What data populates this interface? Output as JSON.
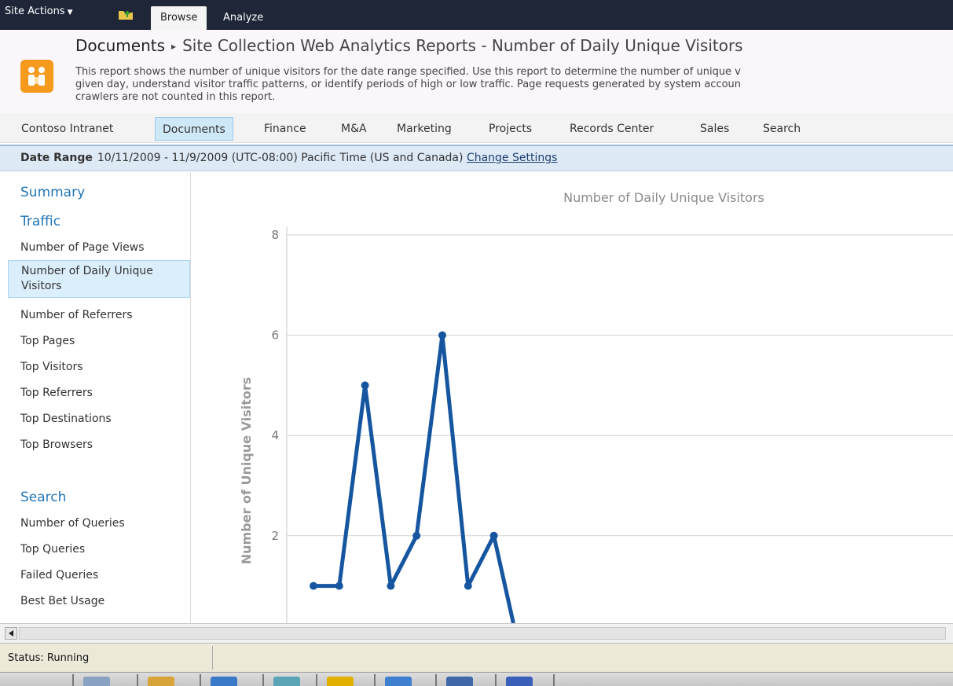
{
  "ribbon": {
    "site_actions_label": "Site Actions",
    "tabs": [
      {
        "label": "Browse",
        "active": true
      },
      {
        "label": "Analyze",
        "active": false
      }
    ]
  },
  "title": {
    "breadcrumb_root": "Documents",
    "breadcrumb_separator": "▸",
    "page_title": "Site Collection Web Analytics Reports - Number of Daily Unique Visitors",
    "description_lines": [
      "This report shows the number of unique visitors for the date range specified. Use this report to determine the number of unique v",
      "given day, understand visitor traffic patterns, or identify periods of high or low traffic. Page requests generated by system accoun",
      "crawlers are not counted in this report."
    ]
  },
  "topnav": {
    "items": [
      {
        "label": "Contoso Intranet"
      },
      {
        "label": "Documents",
        "selected": true
      },
      {
        "label": "Finance"
      },
      {
        "label": "M&A"
      },
      {
        "label": "Marketing"
      },
      {
        "label": "Projects"
      },
      {
        "label": "Records Center"
      },
      {
        "label": "Sales"
      },
      {
        "label": "Search"
      }
    ]
  },
  "date_range": {
    "label": "Date Range",
    "value": "10/11/2009 - 11/9/2009 (UTC-08:00) Pacific Time (US and Canada)",
    "change_link": "Change Settings"
  },
  "quick_launch": {
    "summary": "Summary",
    "traffic_heading": "Traffic",
    "traffic_items": [
      "Number of Page Views",
      "Number of Daily Unique Visitors",
      "Number of Referrers",
      "Top Pages",
      "Top Visitors",
      "Top Referrers",
      "Top Destinations",
      "Top Browsers"
    ],
    "selected_item": "Number of Daily Unique Visitors",
    "search_heading": "Search",
    "search_items": [
      "Number of Queries",
      "Top Queries",
      "Failed Queries",
      "Best Bet Usage"
    ]
  },
  "chart_data": {
    "type": "line",
    "title": "Number of Daily Unique Visitors",
    "ylabel": "Number of Unique Visitors",
    "xlabel": "",
    "ylim": [
      0,
      8
    ],
    "yticks": [
      2,
      4,
      6,
      8
    ],
    "grid": true,
    "color": "#1656a0",
    "series": [
      {
        "values": [
          1,
          1,
          5,
          1,
          2,
          6,
          1,
          2
        ]
      }
    ]
  },
  "status": {
    "text": "Status: Running"
  },
  "taskbar": {
    "icon_colors": [
      "#8aa2c2",
      "#d8a43a",
      "#3a78c8",
      "#5aa5b5",
      "#e0b000",
      "#3f7fd0",
      "#4068a8",
      "#3a5fb8"
    ]
  },
  "colors": {
    "ribbon": "#1e2638",
    "accent": "#1f74b8",
    "chart_line": "#1656a0"
  }
}
